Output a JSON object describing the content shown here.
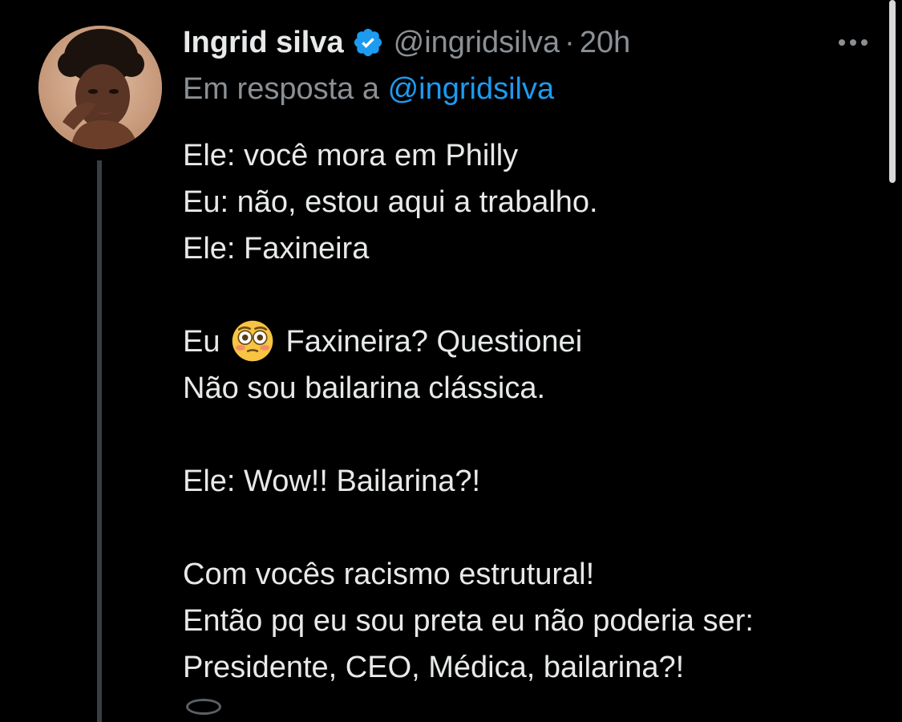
{
  "author": {
    "name": "Ingrid silva",
    "handle": "@ingridsilva",
    "separator": "·",
    "time": "20h",
    "avatar_icon": "profile-photo"
  },
  "reply_context": {
    "prefix": "Em resposta a",
    "mention": "@ingridsilva"
  },
  "tweet": {
    "line1": "Ele: você mora em Philly",
    "line2": "Eu: não, estou aqui a trabalho.",
    "line3": "Ele: Faxineira",
    "line4_before": "Eu",
    "line4_after": "Faxineira? Questionei",
    "line5": "Não sou bailarina clássica.",
    "line6": "Ele: Wow!! Bailarina?!",
    "line7": "Com vocês racismo estrutural!",
    "line8": "Então pq eu sou preta eu não poderia ser:",
    "line9": "Presidente, CEO, Médica, bailarina?!"
  },
  "colors": {
    "background": "#000000",
    "text": "#e7e9ea",
    "muted": "#8b9095",
    "accent": "#1d9bf0",
    "verified": "#1d9bf0"
  },
  "icons": {
    "verified": "verified-badge-icon",
    "more": "more-options-icon",
    "emoji": "flushed-face-emoji"
  }
}
